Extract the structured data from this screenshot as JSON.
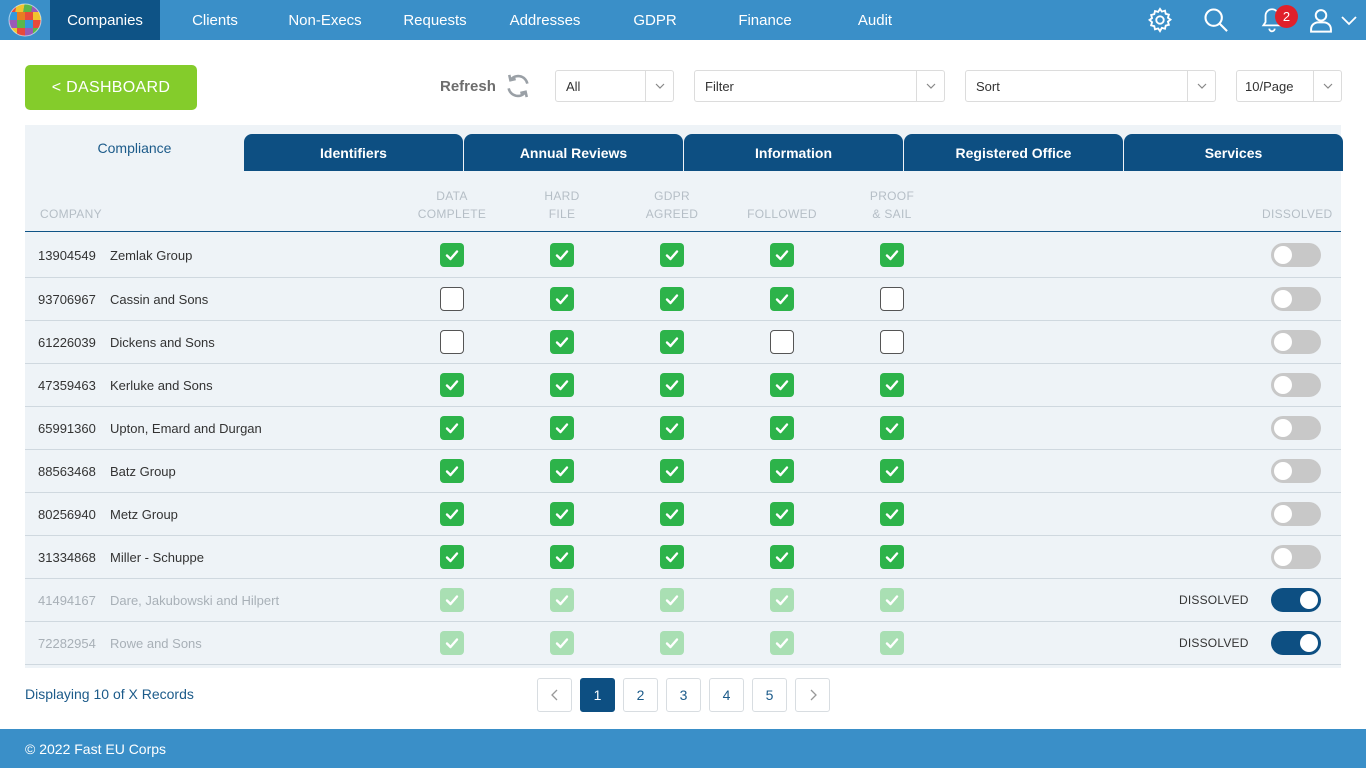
{
  "nav": {
    "items": [
      "Companies",
      "Clients",
      "Non-Execs",
      "Requests",
      "Addresses",
      "GDPR",
      "Finance",
      "Audit"
    ],
    "active_index": 0,
    "notification_count": "2"
  },
  "toolbar": {
    "dashboard_label": "< DASHBOARD",
    "refresh_label": "Refresh",
    "status_select": "All",
    "filter_select": "Filter",
    "sort_select": "Sort",
    "page_size_select": "10/Page"
  },
  "tabs": [
    "Compliance",
    "Identifiers",
    "Annual Reviews",
    "Information",
    "Registered Office",
    "Services"
  ],
  "active_tab_index": 0,
  "table": {
    "company_header": "COMPANY",
    "columns": [
      {
        "line1": "DATA",
        "line2": "COMPLETE"
      },
      {
        "line1": "HARD",
        "line2": "FILE"
      },
      {
        "line1": "GDPR",
        "line2": "AGREED"
      },
      {
        "line1": "",
        "line2": "FOLLOWED"
      },
      {
        "line1": "PROOF",
        "line2": "& SAIL"
      }
    ],
    "dissolved_header": "DISSOLVED",
    "dissolved_label": "DISSOLVED",
    "rows": [
      {
        "number": "13904549",
        "name": "Zemlak Group",
        "checks": [
          true,
          true,
          true,
          true,
          true
        ],
        "dissolved": false
      },
      {
        "number": "93706967",
        "name": "Cassin and Sons",
        "checks": [
          false,
          true,
          true,
          true,
          false
        ],
        "dissolved": false
      },
      {
        "number": "61226039",
        "name": "Dickens and Sons",
        "checks": [
          false,
          true,
          true,
          false,
          false
        ],
        "dissolved": false
      },
      {
        "number": "47359463",
        "name": "Kerluke and Sons",
        "checks": [
          true,
          true,
          true,
          true,
          true
        ],
        "dissolved": false
      },
      {
        "number": "65991360",
        "name": "Upton, Emard and Durgan",
        "checks": [
          true,
          true,
          true,
          true,
          true
        ],
        "dissolved": false
      },
      {
        "number": "88563468",
        "name": "Batz Group",
        "checks": [
          true,
          true,
          true,
          true,
          true
        ],
        "dissolved": false
      },
      {
        "number": "80256940",
        "name": "Metz Group",
        "checks": [
          true,
          true,
          true,
          true,
          true
        ],
        "dissolved": false
      },
      {
        "number": "31334868",
        "name": "Miller - Schuppe",
        "checks": [
          true,
          true,
          true,
          true,
          true
        ],
        "dissolved": false
      },
      {
        "number": "41494167",
        "name": "Dare, Jakubowski and Hilpert",
        "checks": [
          true,
          true,
          true,
          true,
          true
        ],
        "dissolved": true
      },
      {
        "number": "72282954",
        "name": "Rowe and Sons",
        "checks": [
          true,
          true,
          true,
          true,
          true
        ],
        "dissolved": true
      }
    ]
  },
  "pagination": {
    "records_text": "Displaying 10 of X Records",
    "pages": [
      "1",
      "2",
      "3",
      "4",
      "5"
    ],
    "active_page": "1"
  },
  "footer": {
    "copyright": "© 2022 Fast EU Corps"
  },
  "colors": {
    "nav": "#3a8fc8",
    "nav_active": "#0e5386",
    "tab": "#0d4f82",
    "dashboard": "#84cc2b",
    "check": "#2db34a",
    "badge": "#e0202a"
  }
}
